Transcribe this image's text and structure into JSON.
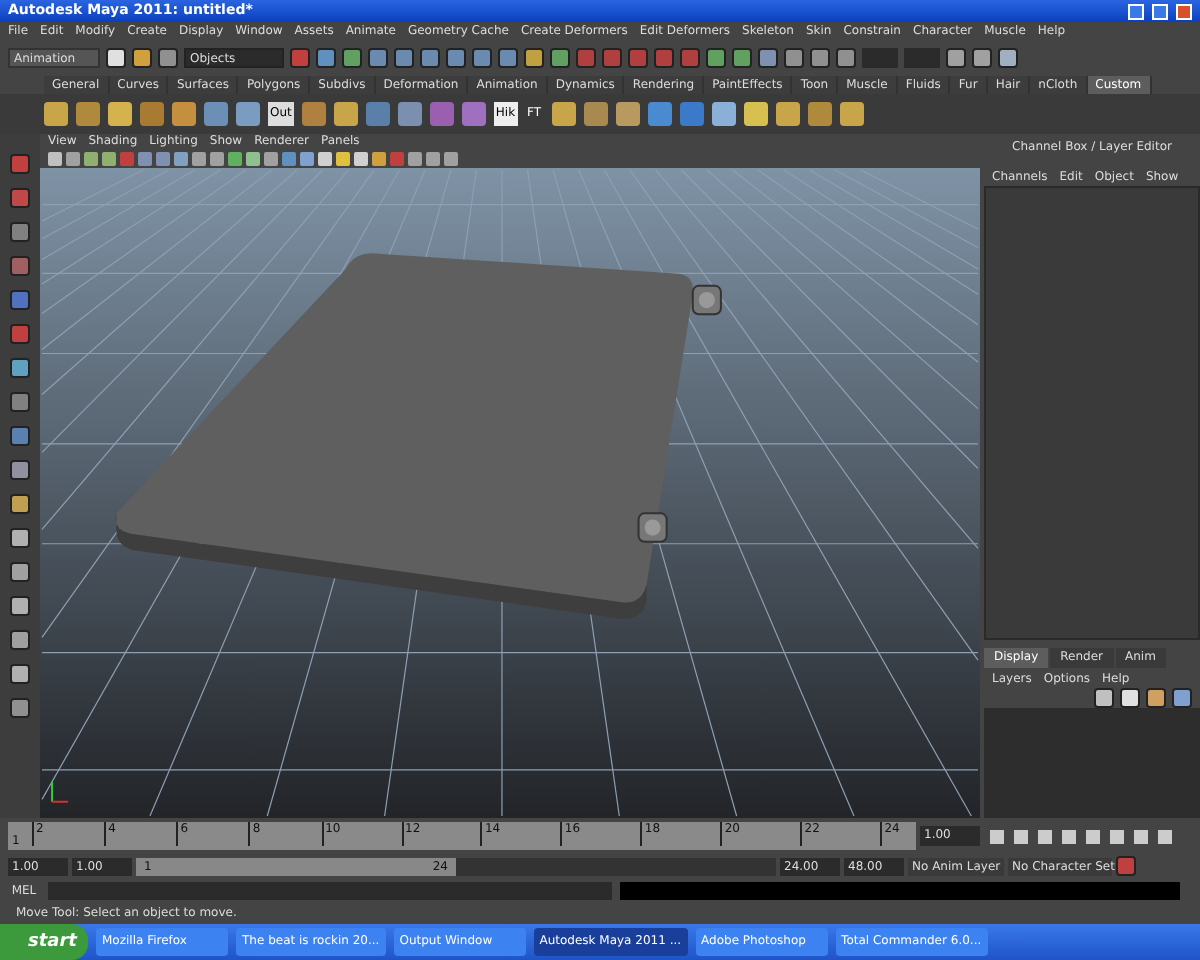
{
  "window": {
    "title": "Autodesk Maya 2011: untitled*"
  },
  "menu_bar": [
    "File",
    "Edit",
    "Modify",
    "Create",
    "Display",
    "Window",
    "Assets",
    "Animate",
    "Geometry Cache",
    "Create Deformers",
    "Edit Deformers",
    "Skeleton",
    "Skin",
    "Constrain",
    "Character",
    "Muscle",
    "Help"
  ],
  "status_line": {
    "menu_set": "Animation",
    "selection_field": {
      "value": "Objects"
    }
  },
  "shelf_tabs": [
    {
      "label": "General",
      "selected": false
    },
    {
      "label": "Curves",
      "selected": false
    },
    {
      "label": "Surfaces",
      "selected": false
    },
    {
      "label": "Polygons",
      "selected": false
    },
    {
      "label": "Subdivs",
      "selected": false
    },
    {
      "label": "Deformation",
      "selected": false
    },
    {
      "label": "Animation",
      "selected": false
    },
    {
      "label": "Dynamics",
      "selected": false
    },
    {
      "label": "Rendering",
      "selected": false
    },
    {
      "label": "PaintEffects",
      "selected": false
    },
    {
      "label": "Toon",
      "selected": false
    },
    {
      "label": "Muscle",
      "selected": false
    },
    {
      "label": "Fluids",
      "selected": false
    },
    {
      "label": "Fur",
      "selected": false
    },
    {
      "label": "Hair",
      "selected": false
    },
    {
      "label": "nCloth",
      "selected": false
    },
    {
      "label": "Custom",
      "selected": true
    }
  ],
  "shelf_icon_labels": {
    "out": "Out",
    "hik": "Hik",
    "ft": "FT"
  },
  "viewport": {
    "menu": [
      "View",
      "Shading",
      "Lighting",
      "Show",
      "Renderer",
      "Panels"
    ]
  },
  "channel_box": {
    "title": "Channel Box / Layer Editor",
    "menu": [
      "Channels",
      "Edit",
      "Object",
      "Show"
    ]
  },
  "layer_editor": {
    "tabs": [
      {
        "label": "Display",
        "selected": true
      },
      {
        "label": "Render",
        "selected": false
      },
      {
        "label": "Anim",
        "selected": false
      }
    ],
    "menu": [
      "Layers",
      "Options",
      "Help"
    ]
  },
  "time_slider": {
    "start_label": "1",
    "ticks": [
      "2",
      "4",
      "6",
      "8",
      "10",
      "12",
      "14",
      "16",
      "18",
      "20",
      "22",
      "24"
    ],
    "current_frame": "1.00"
  },
  "range_slider": {
    "start_time": "1.00",
    "range_start": "1.00",
    "handle_start": "1",
    "handle_end": "24",
    "level": 0.5,
    "range_end": "24.00",
    "end_time": "48.00",
    "anim_layer": "No Anim Layer",
    "character_set": "No Character Set"
  },
  "command_line": {
    "label": "MEL"
  },
  "help_line": "Move Tool: Select an object to move.",
  "taskbar": {
    "start": "start",
    "items": [
      {
        "label": "Mozilla Firefox",
        "selected": false
      },
      {
        "label": "The beat is rockin 20...",
        "selected": false
      },
      {
        "label": "Output Window",
        "selected": false
      },
      {
        "label": "Autodesk Maya 2011 ...",
        "selected": true
      },
      {
        "label": "Adobe Photoshop",
        "selected": false
      },
      {
        "label": "Total Commander 6.0...",
        "selected": false
      }
    ]
  }
}
